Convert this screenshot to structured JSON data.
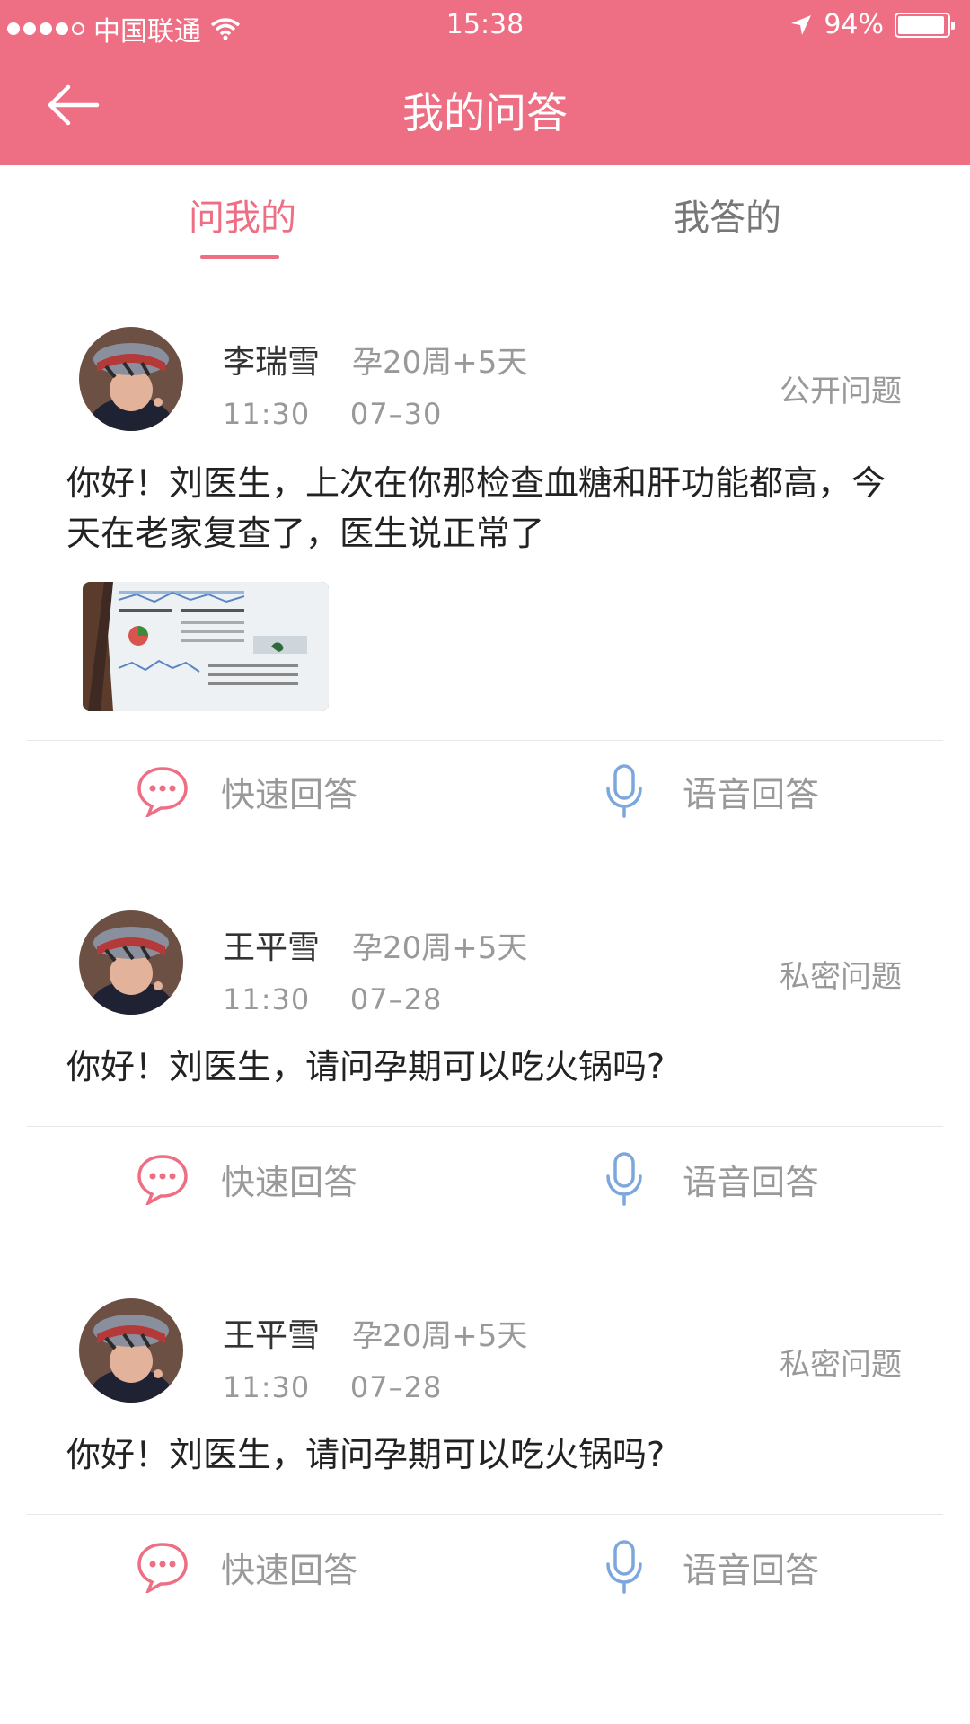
{
  "status": {
    "carrier": "中国联通",
    "time": "15:38",
    "battery": "94%",
    "battery_level": 0.94
  },
  "header": {
    "title": "我的问答"
  },
  "tabs": [
    {
      "label": "问我的"
    },
    {
      "label": "我答的"
    }
  ],
  "colors": {
    "accent": "#ee6e83",
    "mic": "#7ba7dc",
    "muted": "#999999"
  },
  "icons": {
    "back": "arrow-left-icon",
    "quick": "chat-bubble-icon",
    "voice": "microphone-icon"
  },
  "questions": [
    {
      "name": "李瑞雪",
      "week": "孕20周+5天",
      "time": "11:30",
      "date": "07–30",
      "type": "公开问题",
      "text": "你好！刘医生，上次在你那检查血糖和肝功能都高，今天在老家复查了，医生说正常了",
      "quick_label": "快速回答",
      "voice_label": "语音回答"
    },
    {
      "name": "王平雪",
      "week": "孕20周+5天",
      "time": "11:30",
      "date": "07–28",
      "type": "私密问题",
      "text": "你好！刘医生，请问孕期可以吃火锅吗?",
      "quick_label": "快速回答",
      "voice_label": "语音回答"
    },
    {
      "name": "王平雪",
      "week": "孕20周+5天",
      "time": "11:30",
      "date": "07–28",
      "type": "私密问题",
      "text": "你好！刘医生，请问孕期可以吃火锅吗?",
      "quick_label": "快速回答",
      "voice_label": "语音回答"
    }
  ]
}
